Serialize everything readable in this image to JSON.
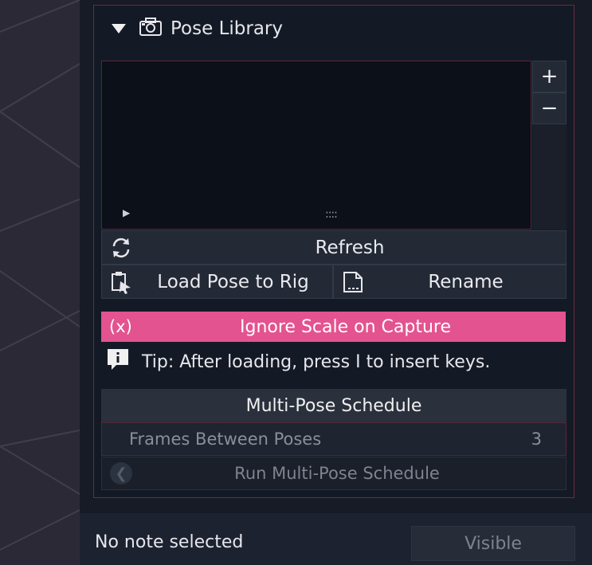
{
  "section": {
    "title": "Pose Library"
  },
  "list_controls": {
    "add": "+",
    "remove": "−",
    "grip": "::::"
  },
  "buttons": {
    "refresh": "Refresh",
    "load_pose": "Load Pose to Rig",
    "rename": "Rename"
  },
  "toggle": {
    "icon_text": "(x)",
    "label": "Ignore Scale on Capture"
  },
  "tip": {
    "text": "Tip: After loading, press I to insert keys."
  },
  "multi_pose": {
    "header": "Multi-Pose Schedule",
    "field_label": "Frames Between Poses",
    "field_value": "3",
    "run_label": "Run Multi-Pose Schedule"
  },
  "status_bar": {
    "note": "No note selected",
    "visible_button": "Visible"
  },
  "colors": {
    "accent_pink": "#e3538f",
    "border_red": "#6b2a3f",
    "panel_bg": "#161b26"
  }
}
